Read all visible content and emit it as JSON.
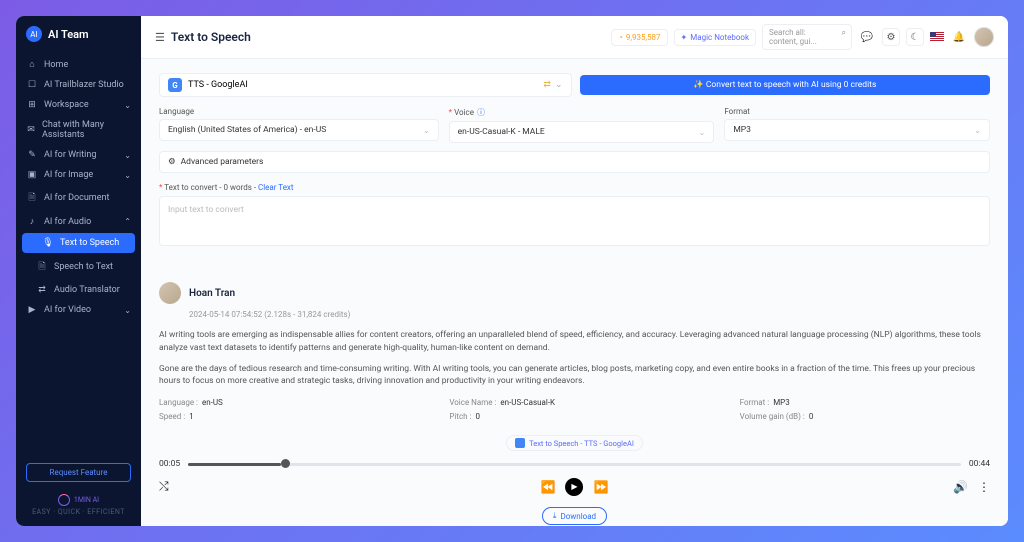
{
  "brand": {
    "name": "AI Team",
    "logo_text": "AI"
  },
  "sidebar": {
    "items": [
      {
        "icon": "⌂",
        "label": "Home"
      },
      {
        "icon": "☐",
        "label": "AI Trailblazer Studio"
      },
      {
        "icon": "⊞",
        "label": "Workspace",
        "chev": true
      },
      {
        "icon": "✉",
        "label": "Chat with Many Assistants"
      },
      {
        "icon": "✎",
        "label": "AI for Writing",
        "chev": true
      },
      {
        "icon": "▣",
        "label": "AI for Image",
        "chev": true
      },
      {
        "icon": "🗎",
        "label": "AI for Document"
      },
      {
        "icon": "♪",
        "label": "AI for Audio",
        "chev": true,
        "open": true
      },
      {
        "icon": "🎙",
        "label": "Text to Speech",
        "sub": true,
        "active": true
      },
      {
        "icon": "🗎",
        "label": "Speech to Text",
        "sub": true
      },
      {
        "icon": "⇄",
        "label": "Audio Translator",
        "sub": true
      },
      {
        "icon": "▶",
        "label": "AI for Video",
        "chev": true
      }
    ],
    "request": "Request Feature",
    "footer_brand": "1MIN AI",
    "footer_tag": "EASY · QUICK · EFFICIENT"
  },
  "topbar": {
    "title": "Text to Speech",
    "credits": "9,935,587",
    "magic": "Magic Notebook",
    "search": "Search all: content, gui..."
  },
  "tts": {
    "provider": "TTS - GoogleAI",
    "convert_label": "✨ Convert text to speech with AI  using 0 credits"
  },
  "form": {
    "lang_label": "Language",
    "lang_value": "English (United States of America) - en-US",
    "voice_label": "Voice",
    "voice_value": "en-US-Casual-K - MALE",
    "format_label": "Format",
    "format_value": "MP3",
    "adv_label": "Advanced parameters",
    "text_prefix": "Text to convert - 0 words -",
    "clear": "Clear Text",
    "placeholder": "Input text to convert"
  },
  "result": {
    "user": "Hoan Tran",
    "meta": "2024-05-14 07:54:52 (2.128s - 31,824 credits)",
    "p1": "AI writing tools are emerging as indispensable allies for content creators, offering an unparalleled blend of speed, efficiency, and accuracy. Leveraging advanced natural language processing (NLP) algorithms, these tools analyze vast text datasets to identify patterns and generate high-quality, human-like content on demand.",
    "p2": "Gone are the days of tedious research and time-consuming writing. With AI writing tools, you can generate articles, blog posts, marketing copy, and even entire books in a fraction of the time. This frees up your precious hours to focus on more creative and strategic tasks, driving innovation and productivity in your writing endeavors.",
    "props": {
      "lang_k": "Language :",
      "lang_v": "en-US",
      "speed_k": "Speed :",
      "speed_v": "1",
      "voice_k": "Voice Name :",
      "voice_v": "en-US-Casual-K",
      "pitch_k": "Pitch :",
      "pitch_v": "0",
      "fmt_k": "Format :",
      "fmt_v": "MP3",
      "gain_k": "Volume gain (dB) :",
      "gain_v": "0"
    },
    "badge": "Text to Speech - TTS - GoogleAI",
    "time_cur": "00:05",
    "time_dur": "00:44",
    "download": "Download"
  }
}
